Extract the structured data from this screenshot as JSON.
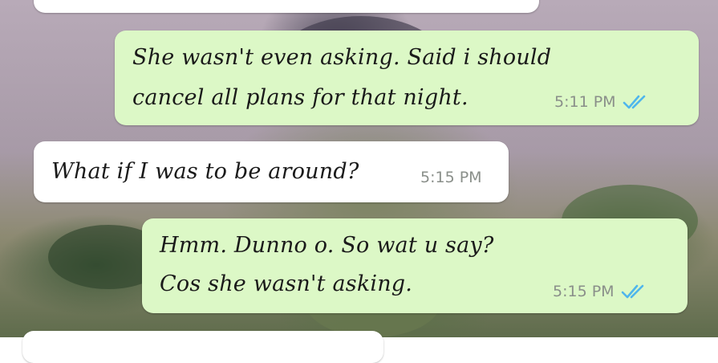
{
  "colors": {
    "outgoing_bubble": "#dcf8c6",
    "incoming_bubble": "#ffffff",
    "read_ticks": "#4fb6ec",
    "time_text": "#8a8f8a"
  },
  "messages": [
    {
      "direction": "outgoing",
      "lines": [
        "She wasn't even asking. Said i should",
        "cancel all plans for that night."
      ],
      "time": "5:11 PM",
      "status": "read"
    },
    {
      "direction": "incoming",
      "lines": [
        "What if I was to be around?"
      ],
      "time": "5:15 PM"
    },
    {
      "direction": "outgoing",
      "lines": [
        "Hmm. Dunno o. So wat u say?",
        "Cos she wasn't asking."
      ],
      "time": "5:15 PM",
      "status": "read"
    }
  ],
  "icons": {
    "read_receipt": "double-check-icon"
  }
}
